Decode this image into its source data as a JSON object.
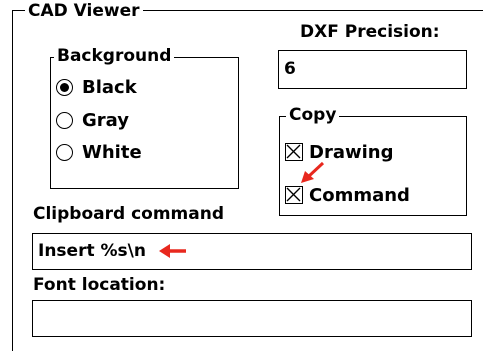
{
  "group_title": "CAD Viewer",
  "dxf_precision": {
    "label": "DXF Precision:",
    "value": "6"
  },
  "background": {
    "title": "Background",
    "options": [
      {
        "label": "Black",
        "selected": true
      },
      {
        "label": "Gray",
        "selected": false
      },
      {
        "label": "White",
        "selected": false
      }
    ]
  },
  "copy": {
    "title": "Copy",
    "options": [
      {
        "label": "Drawing",
        "checked": true
      },
      {
        "label": "Command",
        "checked": true
      }
    ]
  },
  "clipboard_command": {
    "label": "Clipboard command",
    "value": "Insert %s\\n"
  },
  "font_location": {
    "label": "Font location:",
    "value": ""
  },
  "colors": {
    "annotation_arrow": "#e8281e"
  }
}
